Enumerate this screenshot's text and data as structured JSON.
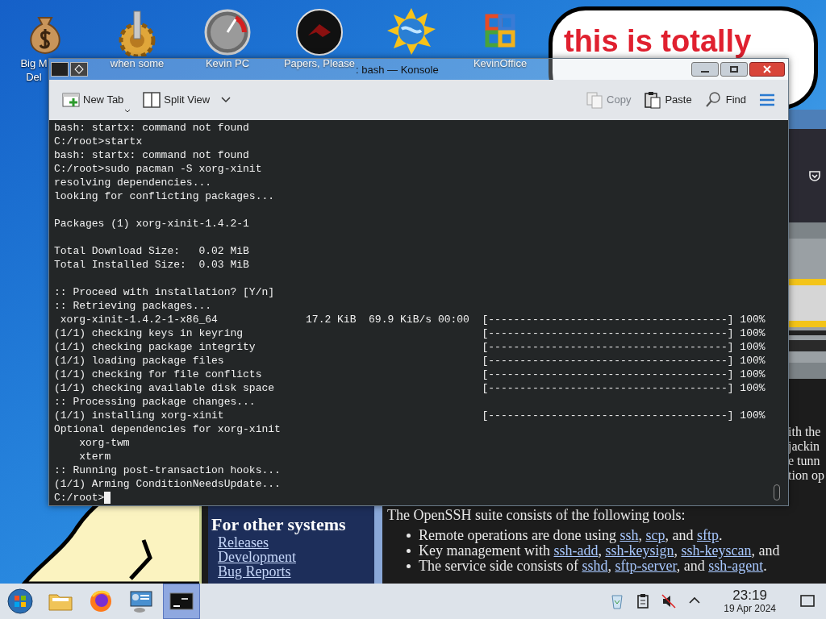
{
  "desktop_icons": [
    {
      "kind": "money-bag",
      "lines": [
        "Big M",
        "Del"
      ]
    },
    {
      "kind": "gear",
      "lines": [
        "when some"
      ]
    },
    {
      "kind": "gauge",
      "lines": [
        "Kevin PC"
      ]
    },
    {
      "kind": "emblem",
      "lines": [
        "Papers, Please"
      ]
    },
    {
      "kind": "globe"
    },
    {
      "kind": "office",
      "lines": [
        "KevinOffice"
      ]
    }
  ],
  "speech_bubble": {
    "lines": [
      "this is totally"
    ]
  },
  "konsole": {
    "title": ": bash — Konsole",
    "toolbar": [
      {
        "kind": "new-tab",
        "label": "New Tab",
        "disabled": false
      },
      {
        "kind": "split-view",
        "label": "Split View",
        "disabled": false
      },
      {
        "kind": "copy",
        "label": "Copy",
        "disabled": true
      },
      {
        "kind": "paste",
        "label": "Paste",
        "disabled": false
      },
      {
        "kind": "find",
        "label": "Find",
        "disabled": false
      },
      {
        "kind": "menu",
        "disabled": false
      }
    ],
    "lines": [
      {
        "text": "bash: startx: command not found"
      },
      {
        "text": "C:/root>startx"
      },
      {
        "text": "bash: startx: command not found"
      },
      {
        "text": "C:/root>sudo pacman -S xorg-xinit"
      },
      {
        "text": "resolving dependencies..."
      },
      {
        "text": "looking for conflicting packages..."
      },
      {
        "kind": "blank"
      },
      {
        "text": "Packages (1) xorg-xinit-1.4.2-1"
      },
      {
        "kind": "blank"
      },
      {
        "text": "Total Download Size:   0.02 MiB"
      },
      {
        "text": "Total Installed Size:  0.03 MiB"
      },
      {
        "kind": "blank"
      },
      {
        "text": ":: Proceed with installation? [Y/n]"
      },
      {
        "text": ":: Retrieving packages..."
      },
      {
        "text": " xorg-xinit-1.4.2-1-x86_64              17.2 KiB  69.9 KiB/s 00:00",
        "progress": "[--------------------------------------] 100%"
      },
      {
        "text": "(1/1) checking keys in keyring",
        "progress": "[--------------------------------------] 100%"
      },
      {
        "text": "(1/1) checking package integrity",
        "progress": "[--------------------------------------] 100%"
      },
      {
        "text": "(1/1) loading package files",
        "progress": "[--------------------------------------] 100%"
      },
      {
        "text": "(1/1) checking for file conflicts",
        "progress": "[--------------------------------------] 100%"
      },
      {
        "text": "(1/1) checking available disk space",
        "progress": "[--------------------------------------] 100%"
      },
      {
        "text": ":: Processing package changes..."
      },
      {
        "text": "(1/1) installing xorg-xinit",
        "progress": "[--------------------------------------] 100%"
      },
      {
        "text": "Optional dependencies for xorg-xinit"
      },
      {
        "text": "    xorg-twm"
      },
      {
        "text": "    xterm"
      },
      {
        "text": ":: Running post-transaction hooks..."
      },
      {
        "text": "(1/1) Arming ConditionNeedsUpdate..."
      }
    ],
    "prompt": "C:/root>"
  },
  "browser": {
    "fragments": [
      "ith the",
      "jackin",
      "e tunn",
      "tion op"
    ],
    "sidebar": {
      "heading": "For other systems",
      "links": [
        "Releases",
        "Development",
        "Bug Reports"
      ]
    },
    "intro": "The OpenSSH suite consists of the following tools:",
    "bullets": [
      [
        {
          "text": "Remote operations are done using "
        },
        {
          "link": "ssh"
        },
        {
          "text": ", "
        },
        {
          "link": "scp"
        },
        {
          "text": ", and "
        },
        {
          "link": "sftp"
        },
        {
          "text": "."
        }
      ],
      [
        {
          "text": "Key management with "
        },
        {
          "link": "ssh-add"
        },
        {
          "text": ", "
        },
        {
          "link": "ssh-keysign"
        },
        {
          "text": ", "
        },
        {
          "link": "ssh-keyscan"
        },
        {
          "text": ", and"
        }
      ],
      [
        {
          "text": "The service side consists of "
        },
        {
          "link": "sshd"
        },
        {
          "text": ", "
        },
        {
          "link": "sftp-server"
        },
        {
          "text": ", and "
        },
        {
          "link": "ssh-agent"
        },
        {
          "text": "."
        }
      ]
    ]
  },
  "taskbar": {
    "apps": [
      {
        "kind": "start",
        "selected": false
      },
      {
        "kind": "files",
        "selected": false
      },
      {
        "kind": "firefox",
        "selected": false
      },
      {
        "kind": "settings",
        "selected": false
      },
      {
        "kind": "terminal",
        "selected": true
      }
    ],
    "tray": [
      {
        "kind": "recycle"
      },
      {
        "kind": "clipboard"
      },
      {
        "kind": "muted-speaker"
      },
      {
        "kind": "caret"
      }
    ],
    "time": "23:19",
    "date": "19 Apr 2024"
  }
}
